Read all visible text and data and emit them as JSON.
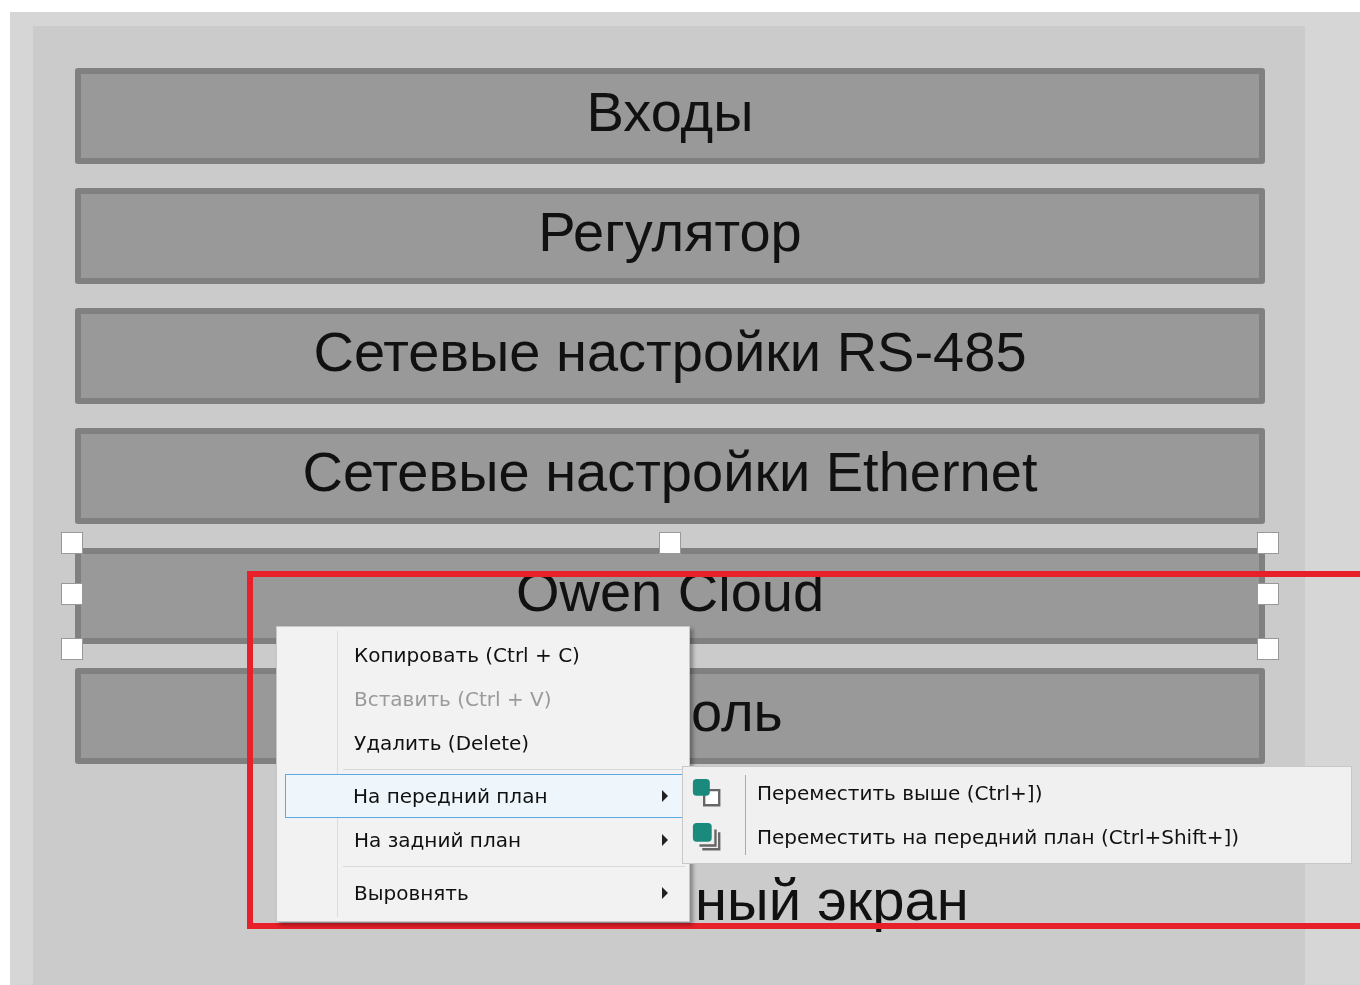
{
  "canvas": {
    "buttons": [
      {
        "label": "Входы",
        "kind": "full",
        "selected": false
      },
      {
        "label": "Регулятор",
        "kind": "full",
        "selected": false
      },
      {
        "label": "Сетевые настройки RS-485",
        "kind": "full",
        "selected": false
      },
      {
        "label": "Сетевые настройки Ethernet",
        "kind": "full",
        "selected": false
      },
      {
        "label": "Owen Cloud",
        "kind": "full",
        "selected": true
      },
      {
        "label": "оль",
        "kind": "covered",
        "selected": false
      }
    ],
    "caption": "ный экран"
  },
  "context_menu": {
    "groups": [
      {
        "items": [
          {
            "label": "Копировать (Ctrl + C)",
            "disabled": false,
            "selected": false,
            "has_submenu": false
          },
          {
            "label": "Вставить (Ctrl + V)",
            "disabled": true,
            "selected": false,
            "has_submenu": false
          },
          {
            "label": "Удалить (Delete)",
            "disabled": false,
            "selected": false,
            "has_submenu": false
          }
        ]
      },
      {
        "items": [
          {
            "label": "На передний план",
            "disabled": false,
            "selected": true,
            "has_submenu": true
          },
          {
            "label": "На задний план",
            "disabled": false,
            "selected": false,
            "has_submenu": true
          }
        ]
      },
      {
        "items": [
          {
            "label": "Выровнять",
            "disabled": false,
            "selected": false,
            "has_submenu": true
          }
        ]
      }
    ]
  },
  "submenu": {
    "items": [
      {
        "label": "Переместить выше (Ctrl+])",
        "kind": "raise"
      },
      {
        "label": "Переместить на передний план (Ctrl+Shift+])",
        "kind": "front"
      }
    ]
  }
}
